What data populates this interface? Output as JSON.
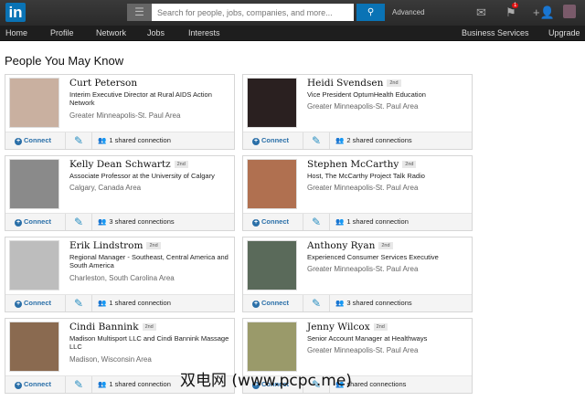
{
  "header": {
    "logo": "in",
    "search_placeholder": "Search for people, jobs, companies, and more...",
    "advanced": "Advanced",
    "notification_count": "1"
  },
  "nav": [
    "Home",
    "Profile",
    "Network",
    "Jobs",
    "Interests",
    "Business Services",
    "Upgrade"
  ],
  "page_title": "People You May Know",
  "labels": {
    "connect": "Connect",
    "degree": "2nd"
  },
  "people": [
    {
      "name": "Curt Peterson",
      "title": "Interim Executive Director at Rural AIDS Action Network",
      "location": "Greater Minneapolis-St. Paul Area",
      "shared": "1 shared connection"
    },
    {
      "name": "Heidi Svendsen",
      "title": "Vice President OptumHealth Education",
      "location": "Greater Minneapolis-St. Paul Area",
      "shared": "2 shared connections"
    },
    {
      "name": "Kelly Dean Schwartz",
      "title": "Associate Professor at the University of Calgary",
      "location": "Calgary, Canada Area",
      "shared": "3 shared connections"
    },
    {
      "name": "Stephen McCarthy",
      "title": "Host, The McCarthy Project Talk Radio",
      "location": "Greater Minneapolis-St. Paul Area",
      "shared": "1 shared connection"
    },
    {
      "name": "Erik Lindstrom",
      "title": "Regional Manager - Southeast, Central America and South America",
      "location": "Charleston, South Carolina Area",
      "shared": "1 shared connection"
    },
    {
      "name": "Anthony Ryan",
      "title": "Experienced Consumer Services Executive",
      "location": "Greater Minneapolis-St. Paul Area",
      "shared": "3 shared connections"
    },
    {
      "name": "Cindi Bannink",
      "title": "Madison Multisport LLC and Cindi Bannink Massage LLC",
      "location": "Madison, Wisconsin Area",
      "shared": "1 shared connection"
    },
    {
      "name": "Jenny Wilcox",
      "title": "Senior Account Manager at Healthways",
      "location": "Greater Minneapolis-St. Paul Area",
      "shared": "shared connections"
    }
  ],
  "watermark": "双电网 (www.pcpc.me)"
}
